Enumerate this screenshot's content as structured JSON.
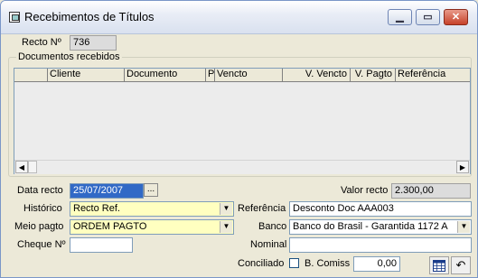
{
  "window": {
    "title": "Recebimentos de Títulos"
  },
  "recto": {
    "label": "Recto Nº",
    "value": "736"
  },
  "documentos": {
    "group_label": "Documentos recebidos",
    "columns": [
      "Cliente",
      "Documento",
      "P",
      "Vencto",
      "V. Vencto",
      "V. Pagto",
      "Referência"
    ]
  },
  "form": {
    "data_recto_label": "Data recto",
    "data_recto_value": "25/07/2007",
    "date_button": "...",
    "valor_recto_label": "Valor recto",
    "valor_recto_value": "2.300,00",
    "historico_label": "Histórico",
    "historico_value": "Recto Ref.",
    "referencia_label": "Referência",
    "referencia_value": "Desconto Doc AAA003",
    "meio_pagto_label": "Meio pagto",
    "meio_pagto_value": "ORDEM PAGTO",
    "banco_label": "Banco",
    "banco_value": "Banco do Brasil - Garantida  1172  A",
    "cheque_label": "Cheque Nº",
    "cheque_value": "",
    "nominal_label": "Nominal",
    "nominal_value": "",
    "conciliado_label": "Conciliado",
    "bcomiss_label": "B. Comiss",
    "bcomiss_value": "0,00"
  },
  "icons": {
    "minimize": "minimize-icon",
    "maximize": "maximize-icon",
    "close": "close-icon",
    "calendar": "calendar-icon",
    "undo": "undo-icon"
  }
}
